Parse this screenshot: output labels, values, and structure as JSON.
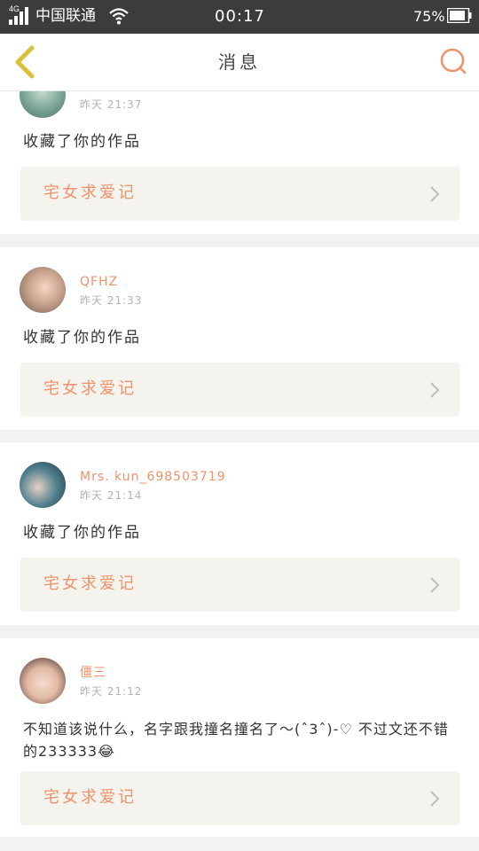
{
  "status_bar": {
    "network": "4G",
    "carrier": "中国联通",
    "time": "00:17",
    "battery_pct": "75%"
  },
  "nav": {
    "title": "消息",
    "back_icon": "chevron-left-icon",
    "search_icon": "search-icon"
  },
  "colors": {
    "accent": "#f0926a",
    "back_arrow": "#d9c13c",
    "card_link_bg": "#f4f3ee"
  },
  "messages": [
    {
      "username": "",
      "time": "昨天 21:37",
      "text": "收藏了你的作品",
      "work_title": "宅女求爱记"
    },
    {
      "username": "QFHZ",
      "time": "昨天 21:33",
      "text": "收藏了你的作品",
      "work_title": "宅女求爱记"
    },
    {
      "username": "Mrs. kun_698503719",
      "time": "昨天 21:14",
      "text": "收藏了你的作品",
      "work_title": "宅女求爱记"
    },
    {
      "username": "僵三",
      "time": "昨天 21:12",
      "text": "不知道该说什么，名字跟我撞名撞名了～(ˆ3ˆ)-♡ 不过文还不错的233333😂",
      "work_title": "宅女求爱记"
    }
  ]
}
